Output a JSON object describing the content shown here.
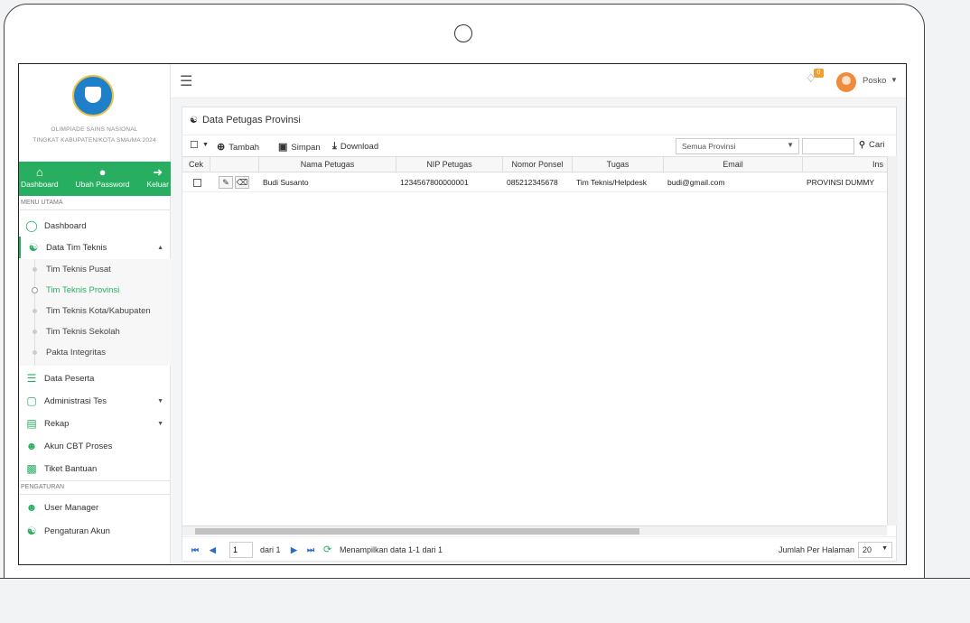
{
  "app": {
    "title": "OLIMPIADE SAINS NASIONAL",
    "subtitle": "TINGKAT KABUPATEN/KOTA SMA/MA 2024"
  },
  "quick_actions": [
    {
      "label": "Dashboard",
      "icon": "home-icon"
    },
    {
      "label": "Ubah Password",
      "icon": "user-settings-icon"
    },
    {
      "label": "Keluar",
      "icon": "logout-icon"
    }
  ],
  "sidebar": {
    "section_main": "MENU UTAMA",
    "section_settings": "PENGATURAN",
    "items": [
      {
        "label": "Dashboard",
        "icon": "dashboard-icon"
      },
      {
        "label": "Data Tim Teknis",
        "icon": "team-icon",
        "expanded": true
      },
      {
        "label": "Data Peserta",
        "icon": "participants-icon"
      },
      {
        "label": "Administrasi Tes",
        "icon": "monitor-icon"
      },
      {
        "label": "Rekap",
        "icon": "chart-icon"
      },
      {
        "label": "Akun CBT Proses",
        "icon": "user-icon"
      },
      {
        "label": "Tiket Bantuan",
        "icon": "ticket-icon"
      },
      {
        "label": "User Manager",
        "icon": "user-icon"
      },
      {
        "label": "Pengaturan Akun",
        "icon": "user-settings-icon"
      }
    ],
    "submenu": [
      {
        "label": "Tim Teknis Pusat"
      },
      {
        "label": "Tim Teknis Provinsi",
        "active": true
      },
      {
        "label": "Tim Teknis Kota/Kabupaten"
      },
      {
        "label": "Tim Teknis Sekolah"
      },
      {
        "label": "Pakta Integritas"
      }
    ]
  },
  "topbar": {
    "notification_count": "0",
    "user_name": "Posko"
  },
  "panel": {
    "title": "Data Petugas Provinsi",
    "toolbar": {
      "add_label": "Tambah",
      "save_label": "Simpan",
      "download_label": "Download",
      "province_filter": "Semua Provinsi",
      "search_value": "",
      "search_label": "Cari"
    },
    "columns": [
      "Cek",
      "",
      "Nama Petugas",
      "NIP Petugas",
      "Nomor Ponsel",
      "Tugas",
      "Email",
      "Ins"
    ],
    "rows": [
      {
        "nama": "Budi Susanto",
        "nip": "1234567800000001",
        "ponsel": "085212345678",
        "tugas": "Tim Teknis/Helpdesk",
        "email": "budi@gmail.com",
        "instansi": "PROVINSI DUMMY"
      }
    ],
    "pager": {
      "page_value": "1",
      "of_pages": "dari 1",
      "info": "Menampilkan data 1-1 dari 1",
      "per_page_label": "Jumlah Per Halaman",
      "per_page_value": "20"
    }
  },
  "colors": {
    "accent": "#27ae60",
    "pager_blue": "#2b6cc4",
    "badge": "#f0a030"
  }
}
